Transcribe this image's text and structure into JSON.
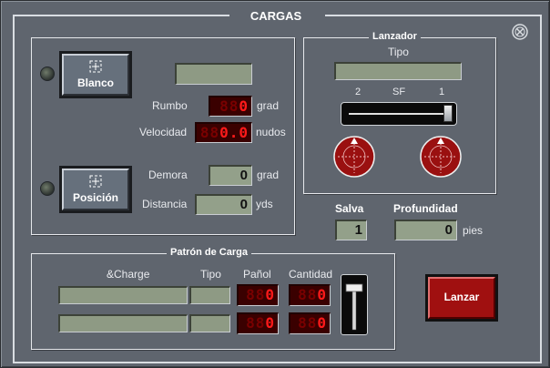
{
  "title": "CARGAS",
  "target": {
    "blanco_label": "Blanco",
    "posicion_label": "Posición",
    "name_value": "",
    "rumbo_label": "Rumbo",
    "rumbo_value": "0",
    "rumbo_unit": "grad",
    "velocidad_label": "Velocidad",
    "velocidad_value": "0.0",
    "velocidad_unit": "nudos",
    "demora_label": "Demora",
    "demora_value": "0",
    "demora_unit": "grad",
    "distancia_label": "Distancia",
    "distancia_value": "0",
    "distancia_unit": "yds"
  },
  "launcher": {
    "title": "Lanzador",
    "tipo_label": "Tipo",
    "tipo_value": "",
    "selector_left": "2",
    "selector_mid": "SF",
    "selector_right": "1",
    "selector_position": 1.0
  },
  "salva": {
    "label": "Salva",
    "value": "1"
  },
  "profundidad": {
    "label": "Profundidad",
    "value": "0",
    "unit": "pies"
  },
  "pattern": {
    "title": "Patrón de Carga",
    "headers": {
      "charge": "&Charge",
      "tipo": "Tipo",
      "panol": "Pañol",
      "cantidad": "Cantidad"
    },
    "rows": [
      {
        "charge": "",
        "tipo": "",
        "panol": "0",
        "cantidad": "0"
      },
      {
        "charge": "",
        "tipo": "",
        "panol": "0",
        "cantidad": "0"
      }
    ]
  },
  "lanzar_label": "Lanzar",
  "colors": {
    "background": "#5f656e",
    "led_on": "#ff1a1a",
    "led_off": "#7a0000",
    "lcd": "#8e9a84",
    "lanzar": "#a01010"
  }
}
